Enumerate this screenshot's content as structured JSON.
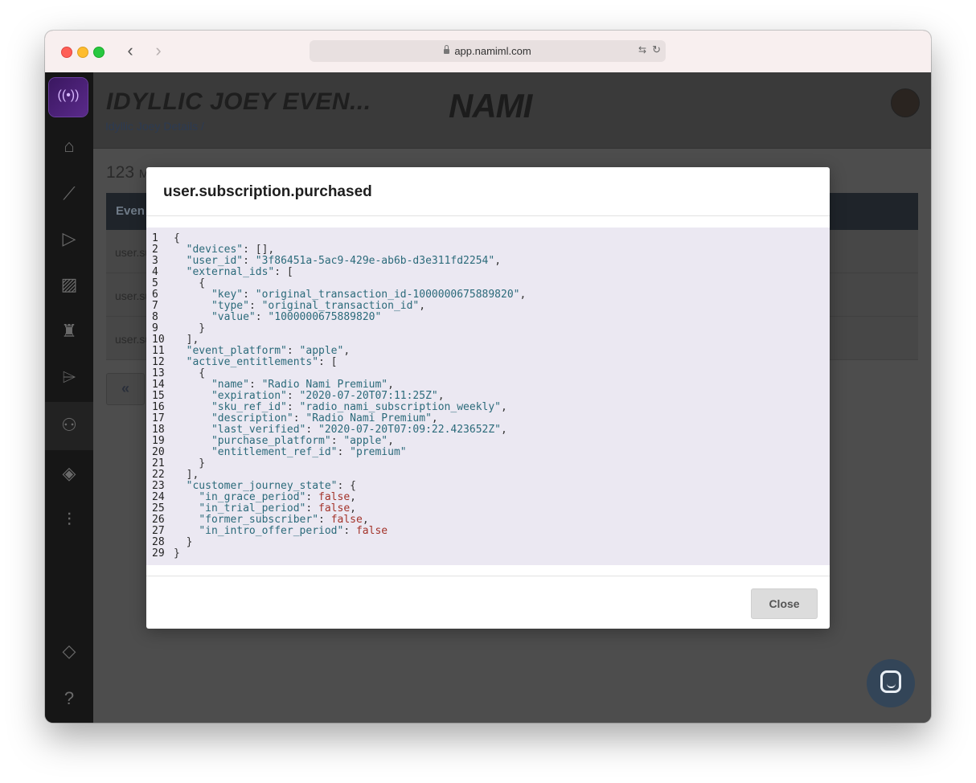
{
  "browser": {
    "url": "app.namiml.com"
  },
  "app": {
    "title": "IDYLLIC JOEY EVEN...",
    "breadcrumb": "Idyllic Joey Details /",
    "brand": "NAMI"
  },
  "main": {
    "count": "123",
    "count_suffix": "M",
    "table_header": "Even",
    "rows": [
      "user.su",
      "user.su",
      "user.su"
    ],
    "pager_prev": "«"
  },
  "modal": {
    "title": "user.subscription.purchased",
    "close_label": "Close",
    "code_lines": [
      "{",
      "  \"devices\": [],",
      "  \"user_id\": \"3f86451a-5ac9-429e-ab6b-d3e311fd2254\",",
      "  \"external_ids\": [",
      "    {",
      "      \"key\": \"original_transaction_id-1000000675889820\",",
      "      \"type\": \"original_transaction_id\",",
      "      \"value\": \"1000000675889820\"",
      "    }",
      "  ],",
      "  \"event_platform\": \"apple\",",
      "  \"active_entitlements\": [",
      "    {",
      "      \"name\": \"Radio Nami Premium\",",
      "      \"expiration\": \"2020-07-20T07:11:25Z\",",
      "      \"sku_ref_id\": \"radio_nami_subscription_weekly\",",
      "      \"description\": \"Radio Nami Premium\",",
      "      \"last_verified\": \"2020-07-20T07:09:22.423652Z\",",
      "      \"purchase_platform\": \"apple\",",
      "      \"entitlement_ref_id\": \"premium\"",
      "    }",
      "  ],",
      "  \"customer_journey_state\": {",
      "    \"in_grace_period\": false,",
      "    \"in_trial_period\": false,",
      "    \"former_subscriber\": false,",
      "    \"in_intro_offer_period\": false",
      "  }",
      "}"
    ]
  },
  "colors": {
    "code_background": "#ebe8f2",
    "json_key": "#2b6a7a",
    "json_boolean": "#a3332a",
    "sidebar": "#161616",
    "chat_button": "#334558"
  }
}
